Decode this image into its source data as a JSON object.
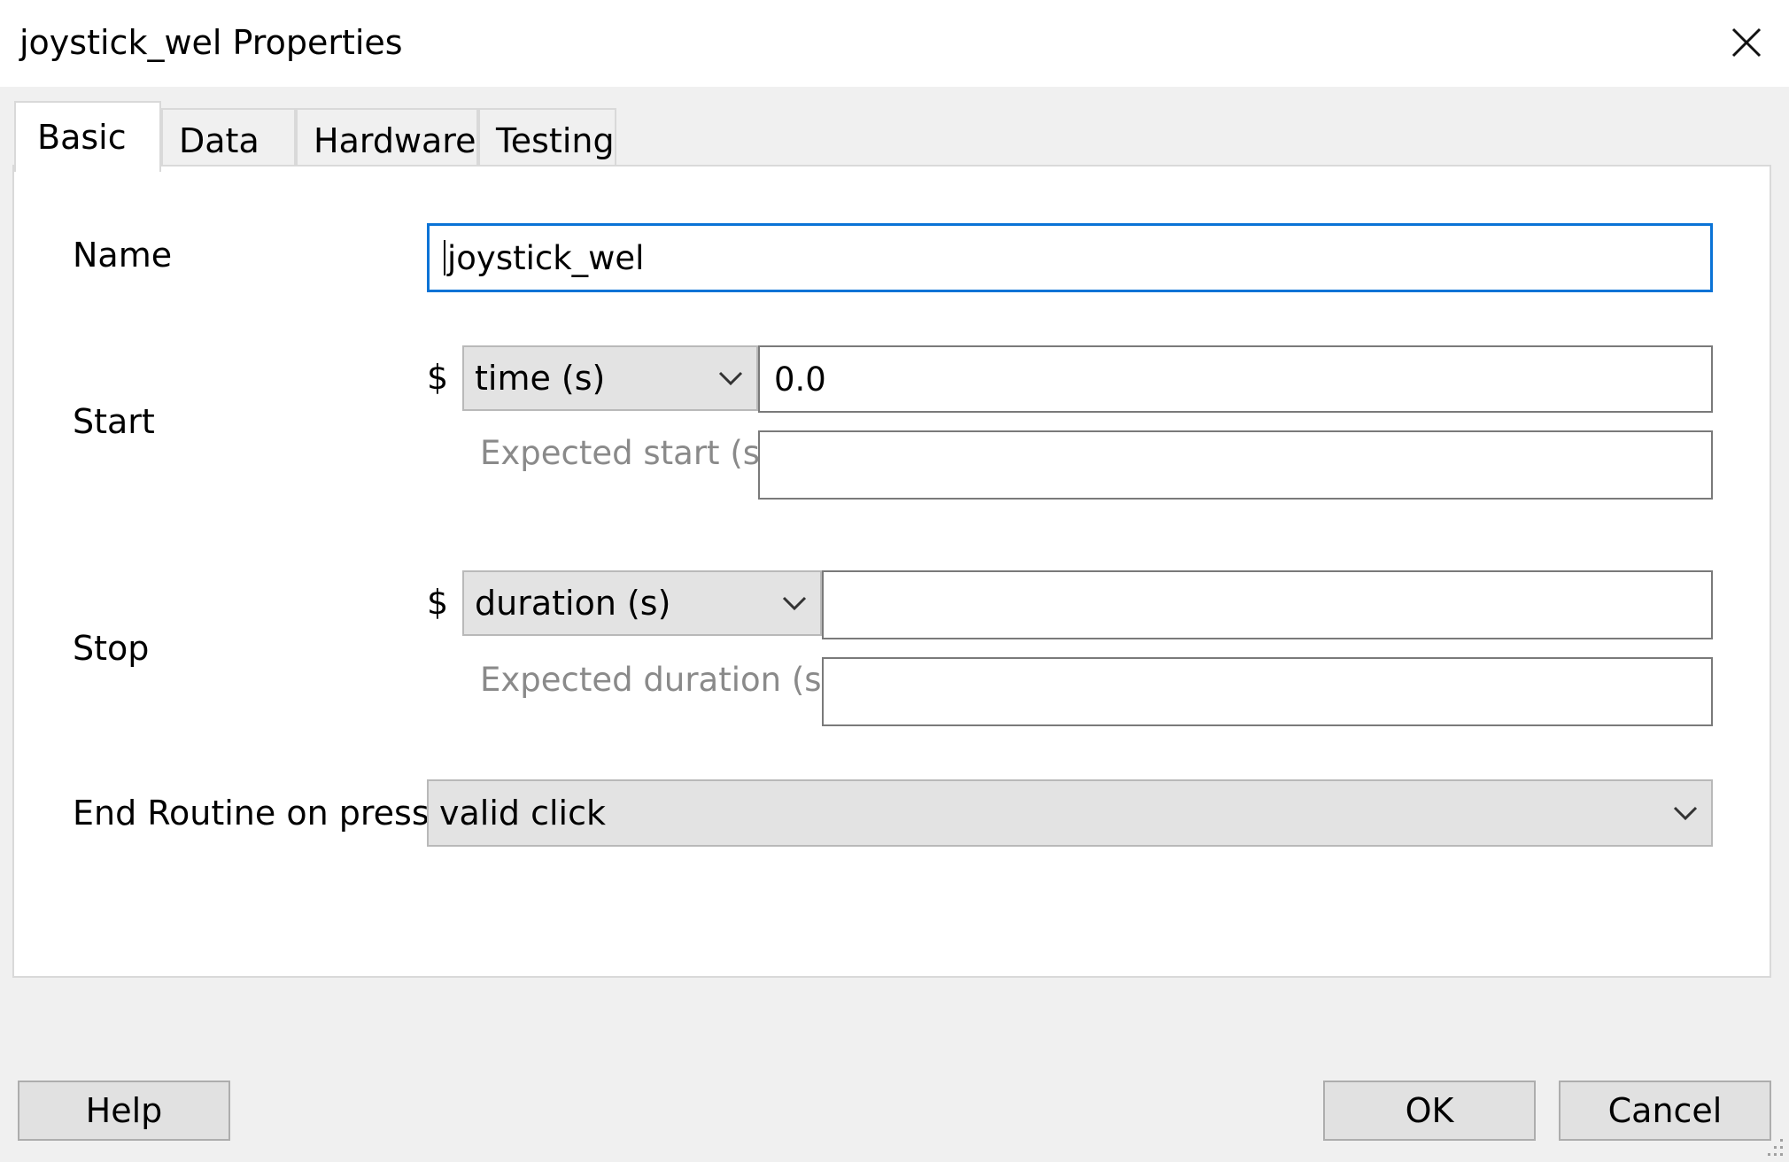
{
  "window": {
    "title": "joystick_wel Properties",
    "close_glyph": "✕"
  },
  "tabs": [
    {
      "label": "Basic",
      "active": true
    },
    {
      "label": "Data",
      "active": false
    },
    {
      "label": "Hardware",
      "active": false
    },
    {
      "label": "Testing",
      "active": false
    }
  ],
  "form": {
    "name": {
      "label": "Name",
      "value": "joystick_wel"
    },
    "start": {
      "label": "Start",
      "dollar": "$",
      "type_selected": "time (s)",
      "value": "0.0",
      "expected_label": "Expected start (s)",
      "expected_value": ""
    },
    "stop": {
      "label": "Stop",
      "dollar": "$",
      "type_selected": "duration (s)",
      "value": "",
      "expected_label": "Expected duration (s)",
      "expected_value": ""
    },
    "end_routine": {
      "label": "End Routine on press",
      "selected": "valid click"
    }
  },
  "buttons": {
    "help": "Help",
    "ok": "OK",
    "cancel": "Cancel"
  },
  "colors": {
    "focus_border": "#0a73d6",
    "window_bg": "#f0f0f0",
    "panel_bg": "#ffffff"
  }
}
